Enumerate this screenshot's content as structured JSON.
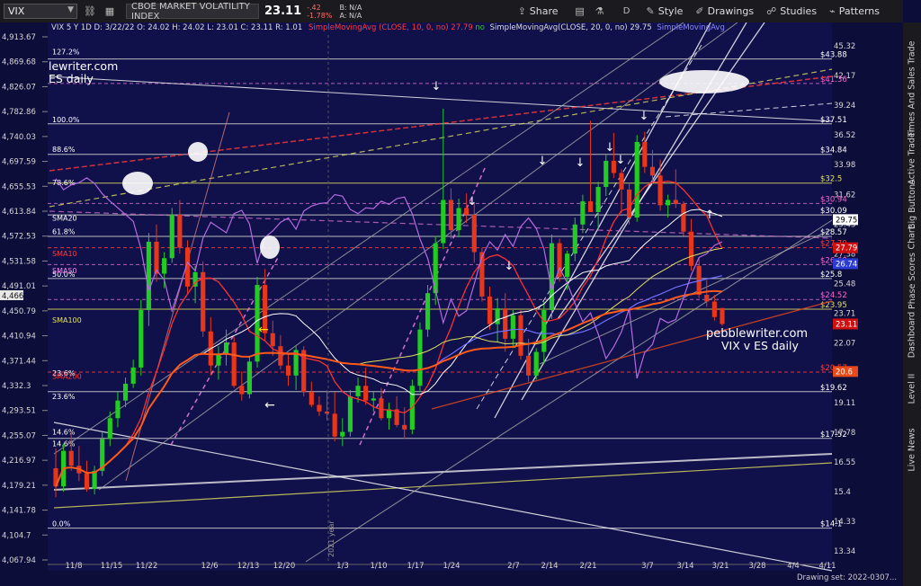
{
  "toolbar": {
    "symbol": "VIX",
    "description": "CBOE MARKET VOLATILITY INDEX",
    "last": "23.11",
    "net_change": "-.42",
    "pct_change": "-1.78%",
    "bid": "B: N/A",
    "ask": "A: N/A",
    "share": "Share",
    "period": "D",
    "style": "Style",
    "drawings": "Drawings",
    "studies": "Studies",
    "patterns": "Patterns"
  },
  "statusbar": {
    "header": "VIX 5 Y 1D  D: 3/22/22  O: 24.02  H: 24.02  L: 23.01  C: 23.11  R: 1.01",
    "sma10": "SimpleMovingAvg (CLOSE, 10, 0, no)",
    "sma10_val": "27.79",
    "no": "no",
    "sma20": "SimpleMovingAvg(CLOSE, 20, 0, no)",
    "sma20_val": "29.75",
    "sma_blue": "SimpleMovingAvg"
  },
  "side_tabs": [
    "Trade",
    "Times And Sales",
    "Active Trader",
    "Big Buttons",
    "Chart",
    "Phase Scores",
    "Dashboard",
    "Level II",
    "Live News"
  ],
  "annotations": {
    "watermark": "pebblewriter.com",
    "subtitle": "VIX v ES daily",
    "top_left": "lewriter.com",
    "top_left2": "ES daily",
    "vertical_year": "2021 year"
  },
  "footer": {
    "drawing_set": "Drawing set: 2022-0307..."
  },
  "chart_data": {
    "type": "candlestick",
    "title": "",
    "x_tick_labels": [
      "11/8",
      "11/15",
      "11/22",
      "12/6",
      "12/13",
      "12/20",
      "1/3",
      "1/10",
      "1/17",
      "1/24",
      "2/7",
      "2/14",
      "2/21",
      "3/7",
      "3/14",
      "3/21",
      "3/28",
      "4/4",
      "4/11"
    ],
    "left_axis_ticks": [
      "4,913.67",
      "4,869.68",
      "4,826.07",
      "4,782.86",
      "4,740.03",
      "4,697.59",
      "4,655.53",
      "4,613.84",
      "4,572.53",
      "4,531.58",
      "4,491.01",
      "4,450.79",
      "4,410.94",
      "4,371.44",
      "4,332.3",
      "4,293.51",
      "4,255.07",
      "4,216.97",
      "4,179.21",
      "4,141.78",
      "4,104.7",
      "4,067.94"
    ],
    "left_axis_marker": "4,466",
    "right_axis_ticks": [
      "45.32",
      "42.17",
      "39.24",
      "36.52",
      "33.98",
      "31.62",
      "29.43",
      "27.38",
      "25.48",
      "23.71",
      "22.07",
      "20.53",
      "19.11",
      "17.78",
      "16.55",
      "15.4",
      "14.33",
      "13.34"
    ],
    "right_axis_markers": [
      {
        "label": "29.75",
        "color": "#ffffff",
        "text_color": "#000000"
      },
      {
        "label": "27.79",
        "color": "#d01010",
        "text_color": "#ffffff"
      },
      {
        "label": "26.74",
        "color": "#2b3bd6",
        "text_color": "#ffffff"
      },
      {
        "label": "23.11",
        "color": "#d01010",
        "text_color": "#ffffff"
      },
      {
        "label": "20.6",
        "color": "#e84a1a",
        "text_color": "#ffffff"
      }
    ],
    "fib_levels_left": [
      "127.2%",
      "100.0%",
      "88.6%",
      "78.6%",
      "61.8%",
      "50.0%",
      "23.6%",
      "14.6%",
      "0.0%"
    ],
    "study_labels_left": [
      "SMA20",
      "SMA10",
      "SMA50",
      "SMA100",
      "SMA200",
      "23.6%",
      "14.6%"
    ],
    "level_labels_right": [
      {
        "label": "$43.88",
        "color": "#ffffff"
      },
      {
        "label": "$41.36",
        "color": "#ff66cc"
      },
      {
        "label": "$37.51",
        "color": "#ffffff"
      },
      {
        "label": "$34.84",
        "color": "#ffffff"
      },
      {
        "label": "$32.5",
        "color": "#e0e060"
      },
      {
        "label": "$30.94",
        "color": "#ff66cc"
      },
      {
        "label": "$30.09",
        "color": "#ffffff"
      },
      {
        "label": "$28.57",
        "color": "#ffffff"
      },
      {
        "label": "$27.79",
        "color": "#ff3b3b"
      },
      {
        "label": "$26.68",
        "color": "#ff66cc"
      },
      {
        "label": "$25.8",
        "color": "#ffffff"
      },
      {
        "label": "$24.52",
        "color": "#ff66cc"
      },
      {
        "label": "$23.95",
        "color": "#e0e060"
      },
      {
        "label": "$20.57",
        "color": "#ff3b3b"
      },
      {
        "label": "$19.62",
        "color": "#ffffff"
      },
      {
        "label": "$17.52",
        "color": "#ffffff"
      },
      {
        "label": "$14.1",
        "color": "#ffffff"
      }
    ],
    "ohlc": [
      [
        16.3,
        17.1,
        15.2,
        15.6
      ],
      [
        15.6,
        17.3,
        15.4,
        17.0
      ],
      [
        17.0,
        17.8,
        16.2,
        16.4
      ],
      [
        16.4,
        17.2,
        15.8,
        16.1
      ],
      [
        16.1,
        16.6,
        15.4,
        15.5
      ],
      [
        15.5,
        16.4,
        15.3,
        16.2
      ],
      [
        16.2,
        17.8,
        16.0,
        17.5
      ],
      [
        17.5,
        18.7,
        17.2,
        18.4
      ],
      [
        18.4,
        19.6,
        18.0,
        19.2
      ],
      [
        19.2,
        20.3,
        18.9,
        20.0
      ],
      [
        20.0,
        21.2,
        19.8,
        20.8
      ],
      [
        20.8,
        24.5,
        20.4,
        23.9
      ],
      [
        23.9,
        28.8,
        23.0,
        28.2
      ],
      [
        28.2,
        29.4,
        25.6,
        26.1
      ],
      [
        26.1,
        27.5,
        25.2,
        27.1
      ],
      [
        27.1,
        30.6,
        26.8,
        30.1
      ],
      [
        30.1,
        31.2,
        27.4,
        27.8
      ],
      [
        27.8,
        28.3,
        24.9,
        25.3
      ],
      [
        25.3,
        26.6,
        24.3,
        26.2
      ],
      [
        26.2,
        26.9,
        22.4,
        22.7
      ],
      [
        22.7,
        23.5,
        20.4,
        20.9
      ],
      [
        20.9,
        21.9,
        20.2,
        21.5
      ],
      [
        21.5,
        22.8,
        20.9,
        22.1
      ],
      [
        22.1,
        22.4,
        19.8,
        19.9
      ],
      [
        19.9,
        20.6,
        19.2,
        19.5
      ],
      [
        19.5,
        21.4,
        19.3,
        21.1
      ],
      [
        21.1,
        25.9,
        20.8,
        25.4
      ],
      [
        25.4,
        26.4,
        22.2,
        22.6
      ],
      [
        22.6,
        23.3,
        21.4,
        21.9
      ],
      [
        21.9,
        22.5,
        20.7,
        20.9
      ],
      [
        20.9,
        21.5,
        19.9,
        20.4
      ],
      [
        20.4,
        21.9,
        19.7,
        21.7
      ],
      [
        21.7,
        21.9,
        19.4,
        19.6
      ],
      [
        19.6,
        20.1,
        18.9,
        19.0
      ],
      [
        19.0,
        19.4,
        18.5,
        18.7
      ],
      [
        18.7,
        19.7,
        18.3,
        18.6
      ],
      [
        18.6,
        19.6,
        17.4,
        17.6
      ],
      [
        17.6,
        18.4,
        17.2,
        17.8
      ],
      [
        17.8,
        19.7,
        17.6,
        19.4
      ],
      [
        19.4,
        20.3,
        19.1,
        19.9
      ],
      [
        19.9,
        20.8,
        19.0,
        19.2
      ],
      [
        19.2,
        19.6,
        18.7,
        19.3
      ],
      [
        19.3,
        19.8,
        18.3,
        18.4
      ],
      [
        18.4,
        19.1,
        17.9,
        18.8
      ],
      [
        18.8,
        19.4,
        18.0,
        18.1
      ],
      [
        18.1,
        18.9,
        17.5,
        17.9
      ],
      [
        17.9,
        20.2,
        17.7,
        19.9
      ],
      [
        19.9,
        23.2,
        19.6,
        22.8
      ],
      [
        22.8,
        25.4,
        22.4,
        24.9
      ],
      [
        24.9,
        28.6,
        24.2,
        28.1
      ],
      [
        28.1,
        38.9,
        27.7,
        31.2
      ],
      [
        31.2,
        32.1,
        28.4,
        29.0
      ],
      [
        29.0,
        31.3,
        28.5,
        30.6
      ],
      [
        30.6,
        31.7,
        29.5,
        30.1
      ],
      [
        30.1,
        31.0,
        26.8,
        27.5
      ],
      [
        27.5,
        27.8,
        24.4,
        24.7
      ],
      [
        24.7,
        25.3,
        22.8,
        23.1
      ],
      [
        23.1,
        24.6,
        22.1,
        24.0
      ],
      [
        24.0,
        24.9,
        21.6,
        22.3
      ],
      [
        22.3,
        23.9,
        21.8,
        23.6
      ],
      [
        23.6,
        23.9,
        21.2,
        21.4
      ],
      [
        21.4,
        22.3,
        20.1,
        20.4
      ],
      [
        20.4,
        21.8,
        20.2,
        21.6
      ],
      [
        21.6,
        24.4,
        21.0,
        23.9
      ],
      [
        23.9,
        28.7,
        23.4,
        28.1
      ],
      [
        28.1,
        28.4,
        25.6,
        25.9
      ],
      [
        25.9,
        27.6,
        25.1,
        27.4
      ],
      [
        27.4,
        29.9,
        26.9,
        29.4
      ],
      [
        29.4,
        31.6,
        28.8,
        31.1
      ],
      [
        31.1,
        37.8,
        30.6,
        30.3
      ],
      [
        30.3,
        32.6,
        29.1,
        32.2
      ],
      [
        32.2,
        34.8,
        31.5,
        34.3
      ],
      [
        34.3,
        36.7,
        32.9,
        33.3
      ],
      [
        33.3,
        33.6,
        30.2,
        32.0
      ],
      [
        32.0,
        32.5,
        29.4,
        29.9
      ],
      [
        29.9,
        36.5,
        29.6,
        35.9
      ],
      [
        35.9,
        36.8,
        33.3,
        33.8
      ],
      [
        33.8,
        35.2,
        32.4,
        33.1
      ],
      [
        33.1,
        34.4,
        30.4,
        30.8
      ],
      [
        30.8,
        31.6,
        29.9,
        31.2
      ],
      [
        31.2,
        33.6,
        30.6,
        30.9
      ],
      [
        30.9,
        31.1,
        28.6,
        28.9
      ],
      [
        28.9,
        29.8,
        26.3,
        26.6
      ],
      [
        26.6,
        27.1,
        24.6,
        24.8
      ],
      [
        24.8,
        25.7,
        24.1,
        24.4
      ],
      [
        24.4,
        24.8,
        23.3,
        23.5
      ],
      [
        24.02,
        24.02,
        23.01,
        23.11
      ]
    ],
    "ylim": [
      13.0,
      46.5
    ],
    "y_scale": "log"
  }
}
